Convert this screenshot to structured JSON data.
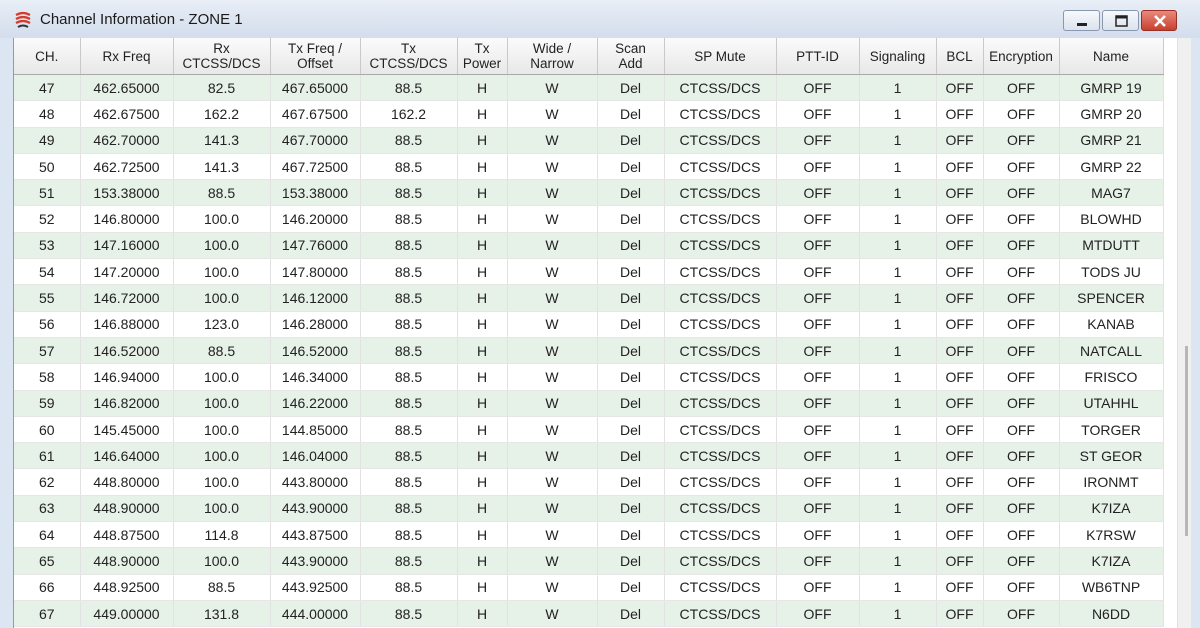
{
  "window": {
    "title": "Channel Information - ZONE 1",
    "accent": "#d63a2c"
  },
  "table": {
    "columns": [
      {
        "l1": "CH.",
        "l2": ""
      },
      {
        "l1": "Rx Freq",
        "l2": ""
      },
      {
        "l1": "Rx",
        "l2": "CTCSS/DCS"
      },
      {
        "l1": "Tx Freq /",
        "l2": "Offset"
      },
      {
        "l1": "Tx",
        "l2": "CTCSS/DCS"
      },
      {
        "l1": "Tx",
        "l2": "Power"
      },
      {
        "l1": "Wide /",
        "l2": "Narrow"
      },
      {
        "l1": "Scan",
        "l2": "Add"
      },
      {
        "l1": "SP Mute",
        "l2": ""
      },
      {
        "l1": "PTT-ID",
        "l2": ""
      },
      {
        "l1": "Signaling",
        "l2": ""
      },
      {
        "l1": "BCL",
        "l2": ""
      },
      {
        "l1": "Encryption",
        "l2": ""
      },
      {
        "l1": "Name",
        "l2": ""
      }
    ],
    "rows": [
      [
        "47",
        "462.65000",
        "82.5",
        "467.65000",
        "88.5",
        "H",
        "W",
        "Del",
        "CTCSS/DCS",
        "OFF",
        "1",
        "OFF",
        "OFF",
        "GMRP 19"
      ],
      [
        "48",
        "462.67500",
        "162.2",
        "467.67500",
        "162.2",
        "H",
        "W",
        "Del",
        "CTCSS/DCS",
        "OFF",
        "1",
        "OFF",
        "OFF",
        "GMRP 20"
      ],
      [
        "49",
        "462.70000",
        "141.3",
        "467.70000",
        "88.5",
        "H",
        "W",
        "Del",
        "CTCSS/DCS",
        "OFF",
        "1",
        "OFF",
        "OFF",
        "GMRP 21"
      ],
      [
        "50",
        "462.72500",
        "141.3",
        "467.72500",
        "88.5",
        "H",
        "W",
        "Del",
        "CTCSS/DCS",
        "OFF",
        "1",
        "OFF",
        "OFF",
        "GMRP 22"
      ],
      [
        "51",
        "153.38000",
        "88.5",
        "153.38000",
        "88.5",
        "H",
        "W",
        "Del",
        "CTCSS/DCS",
        "OFF",
        "1",
        "OFF",
        "OFF",
        "MAG7"
      ],
      [
        "52",
        "146.80000",
        "100.0",
        "146.20000",
        "88.5",
        "H",
        "W",
        "Del",
        "CTCSS/DCS",
        "OFF",
        "1",
        "OFF",
        "OFF",
        "BLOWHD"
      ],
      [
        "53",
        "147.16000",
        "100.0",
        "147.76000",
        "88.5",
        "H",
        "W",
        "Del",
        "CTCSS/DCS",
        "OFF",
        "1",
        "OFF",
        "OFF",
        "MTDUTT"
      ],
      [
        "54",
        "147.20000",
        "100.0",
        "147.80000",
        "88.5",
        "H",
        "W",
        "Del",
        "CTCSS/DCS",
        "OFF",
        "1",
        "OFF",
        "OFF",
        "TODS JU"
      ],
      [
        "55",
        "146.72000",
        "100.0",
        "146.12000",
        "88.5",
        "H",
        "W",
        "Del",
        "CTCSS/DCS",
        "OFF",
        "1",
        "OFF",
        "OFF",
        "SPENCER"
      ],
      [
        "56",
        "146.88000",
        "123.0",
        "146.28000",
        "88.5",
        "H",
        "W",
        "Del",
        "CTCSS/DCS",
        "OFF",
        "1",
        "OFF",
        "OFF",
        "KANAB"
      ],
      [
        "57",
        "146.52000",
        "88.5",
        "146.52000",
        "88.5",
        "H",
        "W",
        "Del",
        "CTCSS/DCS",
        "OFF",
        "1",
        "OFF",
        "OFF",
        "NATCALL"
      ],
      [
        "58",
        "146.94000",
        "100.0",
        "146.34000",
        "88.5",
        "H",
        "W",
        "Del",
        "CTCSS/DCS",
        "OFF",
        "1",
        "OFF",
        "OFF",
        "FRISCO"
      ],
      [
        "59",
        "146.82000",
        "100.0",
        "146.22000",
        "88.5",
        "H",
        "W",
        "Del",
        "CTCSS/DCS",
        "OFF",
        "1",
        "OFF",
        "OFF",
        "UTAHHL"
      ],
      [
        "60",
        "145.45000",
        "100.0",
        "144.85000",
        "88.5",
        "H",
        "W",
        "Del",
        "CTCSS/DCS",
        "OFF",
        "1",
        "OFF",
        "OFF",
        "TORGER"
      ],
      [
        "61",
        "146.64000",
        "100.0",
        "146.04000",
        "88.5",
        "H",
        "W",
        "Del",
        "CTCSS/DCS",
        "OFF",
        "1",
        "OFF",
        "OFF",
        "ST GEOR"
      ],
      [
        "62",
        "448.80000",
        "100.0",
        "443.80000",
        "88.5",
        "H",
        "W",
        "Del",
        "CTCSS/DCS",
        "OFF",
        "1",
        "OFF",
        "OFF",
        "IRONMT"
      ],
      [
        "63",
        "448.90000",
        "100.0",
        "443.90000",
        "88.5",
        "H",
        "W",
        "Del",
        "CTCSS/DCS",
        "OFF",
        "1",
        "OFF",
        "OFF",
        "K7IZA"
      ],
      [
        "64",
        "448.87500",
        "114.8",
        "443.87500",
        "88.5",
        "H",
        "W",
        "Del",
        "CTCSS/DCS",
        "OFF",
        "1",
        "OFF",
        "OFF",
        "K7RSW"
      ],
      [
        "65",
        "448.90000",
        "100.0",
        "443.90000",
        "88.5",
        "H",
        "W",
        "Del",
        "CTCSS/DCS",
        "OFF",
        "1",
        "OFF",
        "OFF",
        "K7IZA"
      ],
      [
        "66",
        "448.92500",
        "88.5",
        "443.92500",
        "88.5",
        "H",
        "W",
        "Del",
        "CTCSS/DCS",
        "OFF",
        "1",
        "OFF",
        "OFF",
        "WB6TNP"
      ],
      [
        "67",
        "449.00000",
        "131.8",
        "444.00000",
        "88.5",
        "H",
        "W",
        "Del",
        "CTCSS/DCS",
        "OFF",
        "1",
        "OFF",
        "OFF",
        "N6DD"
      ]
    ],
    "row_colors": {
      "odd": "#e6f1e8",
      "even": "#ffffff"
    }
  }
}
